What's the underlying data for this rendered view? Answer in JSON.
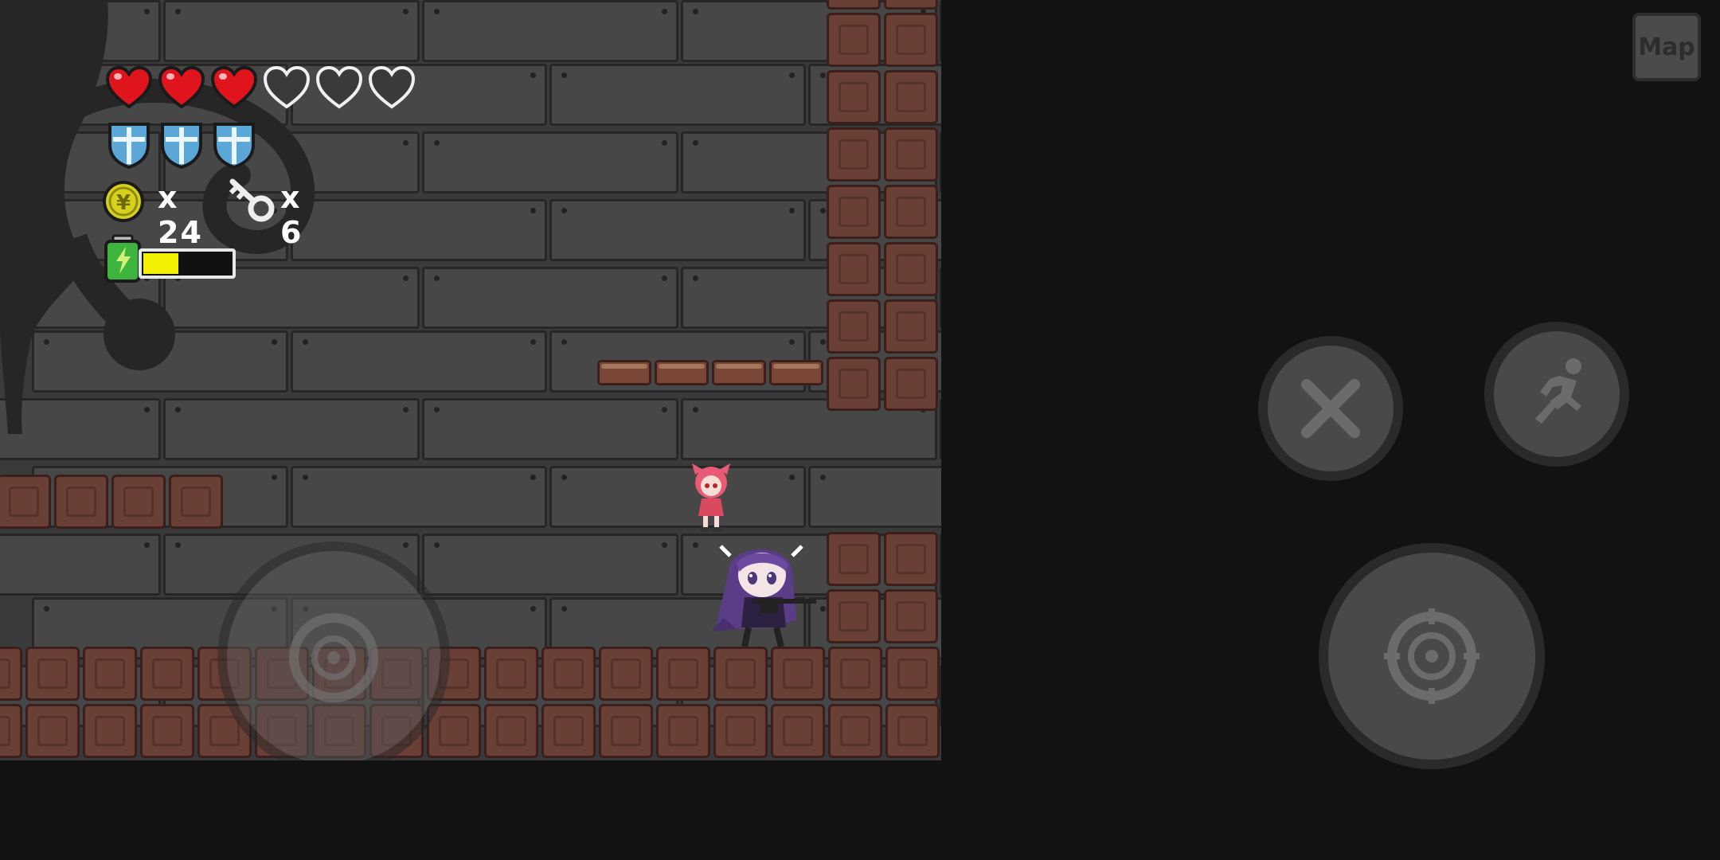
{
  "hud": {
    "hearts_total": 6,
    "hearts_filled": 3,
    "shields": 3,
    "coin_count": "x 24",
    "key_count": "x 6",
    "energy_fraction": 0.4
  },
  "buttons": {
    "map_label": "Map",
    "cancel": "close-icon",
    "dash": "running-icon",
    "aim": "crosshair-icon",
    "move": "joystick"
  },
  "colors": {
    "heart": "#e0141c",
    "shield": "#5aa7d8",
    "coin": "#d6d21c",
    "energy": "#f2ef00",
    "brick": "#6a3f36"
  }
}
